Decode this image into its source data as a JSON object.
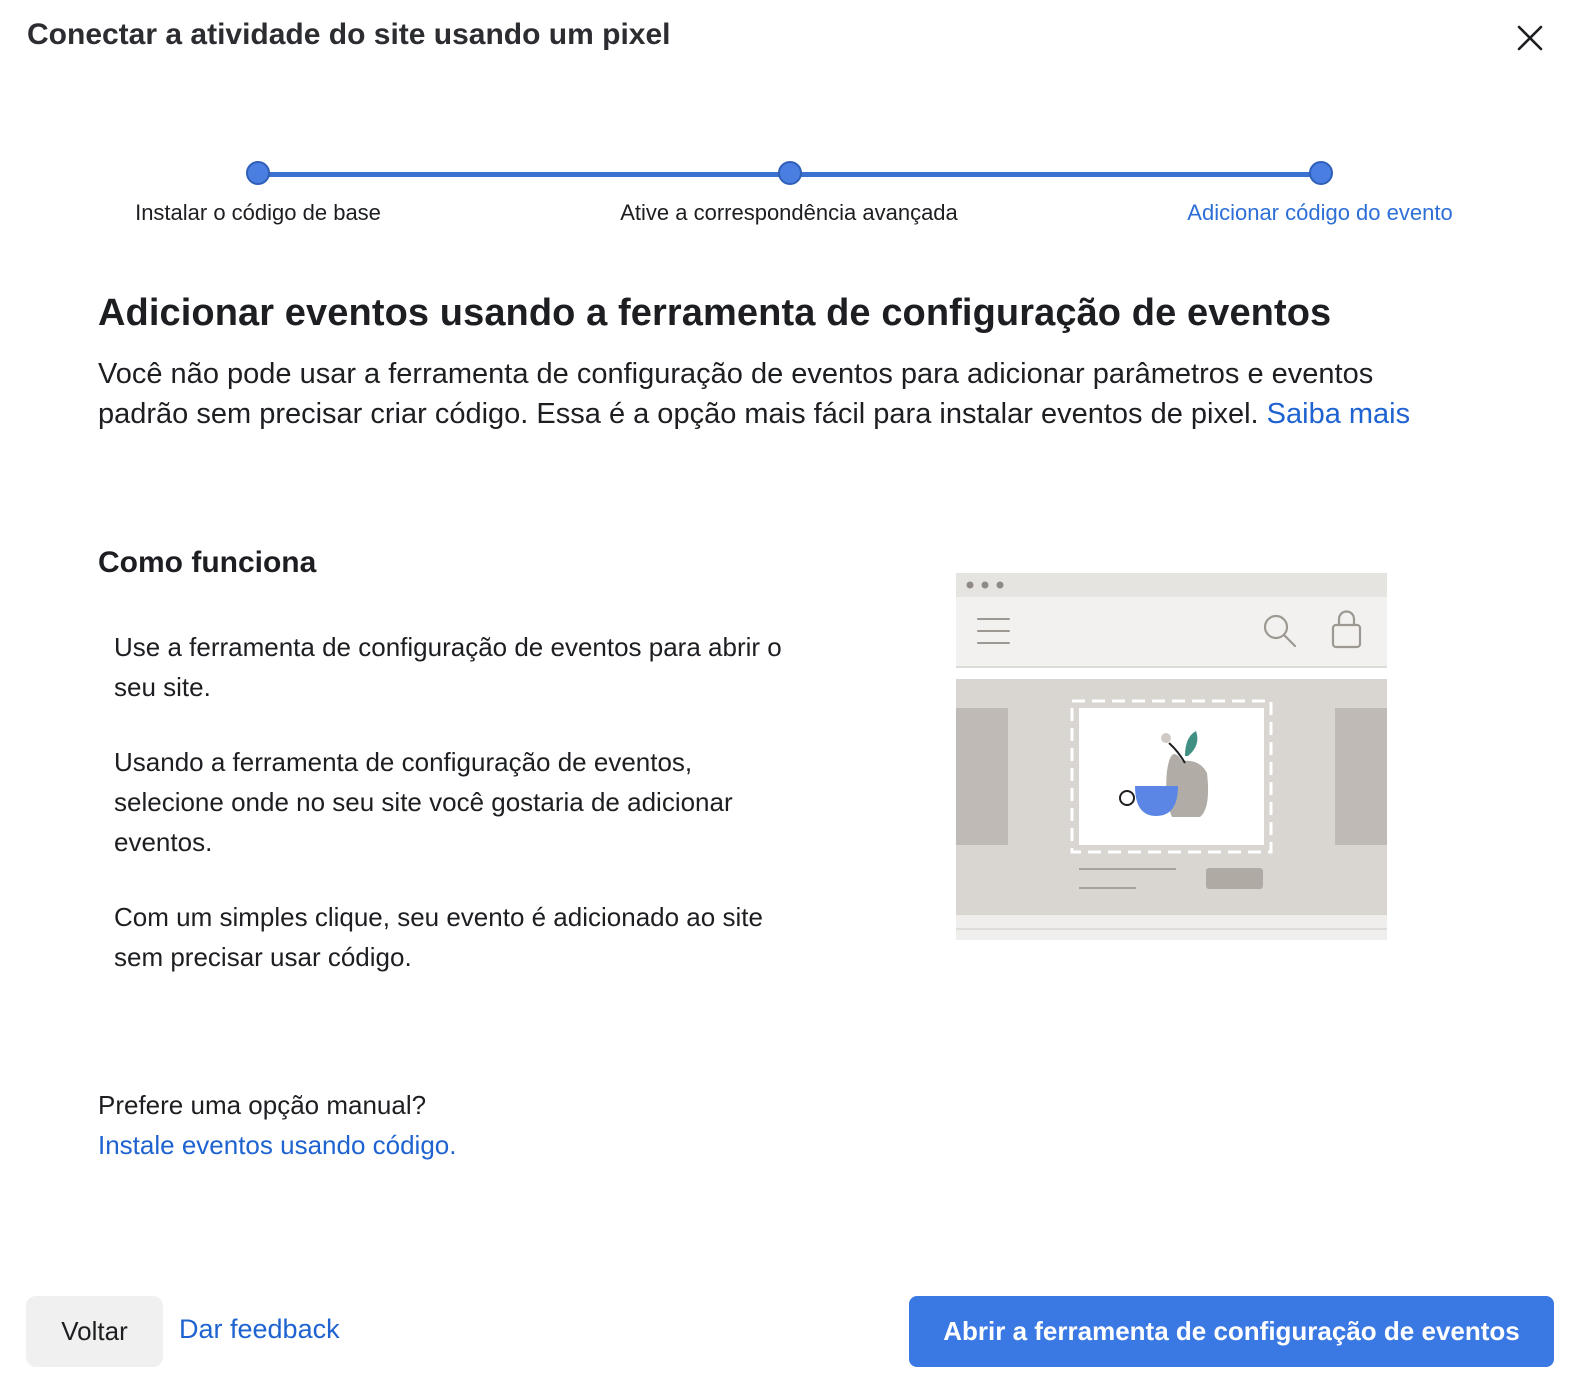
{
  "dialog": {
    "title": "Conectar a atividade do site usando um pixel"
  },
  "stepper": {
    "steps": [
      {
        "label": "Instalar o código de base",
        "state": "completed"
      },
      {
        "label": "Ative a correspondência avançada",
        "state": "completed"
      },
      {
        "label": "Adicionar código do evento",
        "state": "current"
      }
    ]
  },
  "main": {
    "heading": "Adicionar eventos usando a ferramenta de configuração de eventos",
    "intro_text": "Você não pode usar a ferramenta de configuração de eventos para adicionar parâmetros e eventos padrão sem precisar criar código. Essa é a opção mais fácil para instalar eventos de pixel.",
    "intro_link": "Saiba mais",
    "how_title": "Como funciona",
    "how_items": [
      "Use a ferramenta de configuração de eventos para abrir o seu site.",
      "Usando a ferramenta de configuração de eventos, selecione onde no seu site você gostaria de adicionar eventos.",
      "Com um simples clique, seu evento é adicionado ao site sem precisar usar código."
    ],
    "manual_question": "Prefere uma opção manual?",
    "manual_link": "Instale eventos usando código."
  },
  "footer": {
    "back_label": "Voltar",
    "feedback_label": "Dar feedback",
    "primary_label": "Abrir a ferramenta de configuração de eventos"
  },
  "colors": {
    "accent": "#3a78e3",
    "link": "#1e63d0",
    "step": "#4a7ee0"
  },
  "icons": [
    "close-icon",
    "hamburger-menu-icon",
    "search-icon",
    "shopping-bag-icon"
  ]
}
